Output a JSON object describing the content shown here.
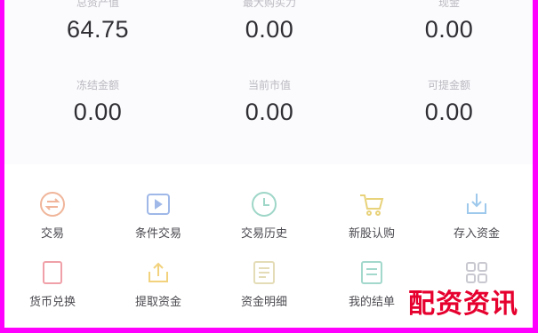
{
  "stats": [
    {
      "label": "总资产值",
      "value": "64.75"
    },
    {
      "label": "最大购买力",
      "value": "0.00"
    },
    {
      "label": "现金",
      "value": "0.00"
    },
    {
      "label": "冻结金额",
      "value": "0.00"
    },
    {
      "label": "当前市值",
      "value": "0.00"
    },
    {
      "label": "可提金额",
      "value": "0.00"
    }
  ],
  "menu": [
    {
      "label": "交易",
      "icon": "exchange-icon",
      "color": "#f0b59a"
    },
    {
      "label": "条件交易",
      "icon": "condition-trade-icon",
      "color": "#9fb8e8"
    },
    {
      "label": "交易历史",
      "icon": "clock-icon",
      "color": "#9ed6c7"
    },
    {
      "label": "新股认购",
      "icon": "cart-icon",
      "color": "#e8d27a"
    },
    {
      "label": "存入资金",
      "icon": "deposit-icon",
      "color": "#9ec9ec"
    },
    {
      "label": "货币兑换",
      "icon": "currency-exchange-icon",
      "color": "#f0a0a8"
    },
    {
      "label": "提取资金",
      "icon": "withdraw-icon",
      "color": "#f2d27c"
    },
    {
      "label": "资金明细",
      "icon": "fund-detail-icon",
      "color": "#e4dcb6"
    },
    {
      "label": "我的结单",
      "icon": "statement-icon",
      "color": "#a3d8cc"
    },
    {
      "label": "",
      "icon": "grid-icon",
      "color": "#c8c8d0"
    }
  ],
  "watermark": "配资资讯"
}
